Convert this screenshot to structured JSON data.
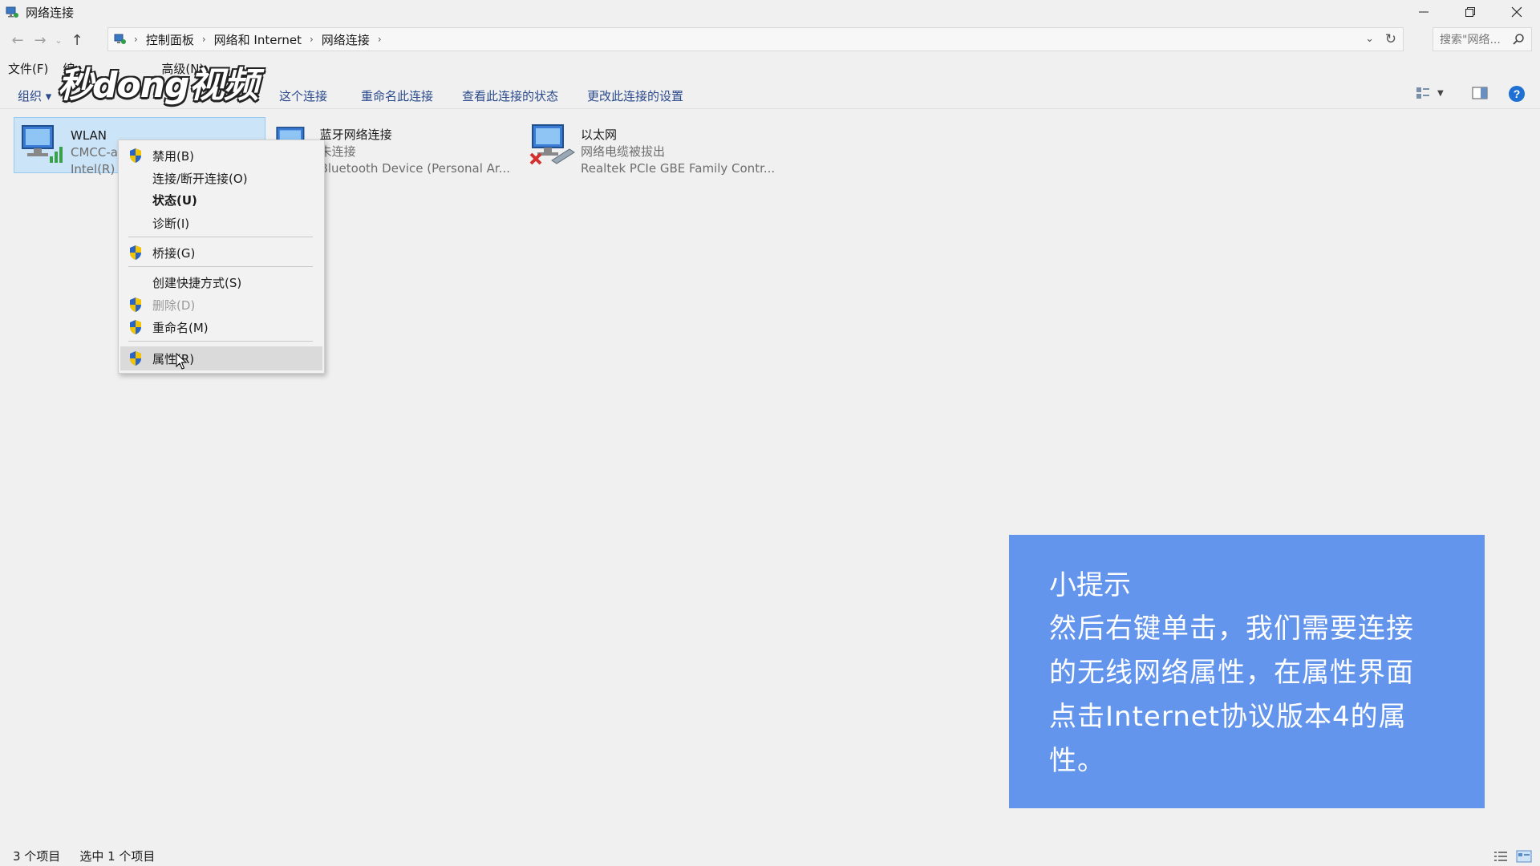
{
  "window": {
    "title": "网络连接",
    "controls": [
      "minimize",
      "restore",
      "close"
    ]
  },
  "address": {
    "crumbs": [
      "控制面板",
      "网络和 Internet",
      "网络连接"
    ],
    "search_placeholder": "搜索\"网络..."
  },
  "menubar": {
    "items": [
      "文件(F)",
      "编",
      "高级(N)"
    ]
  },
  "commandbar": {
    "organize": "组织 ▾",
    "items": [
      "这个连接",
      "重命名此连接",
      "查看此连接的状态",
      "更改此连接的设置"
    ]
  },
  "connections": [
    {
      "name": "WLAN",
      "line1": "CMCC-a",
      "line2": "Intel(R)",
      "icon": "wifi-network-icon"
    },
    {
      "name": "蓝牙网络连接",
      "line1": "未连接",
      "line2": "Bluetooth Device (Personal Ar...",
      "icon": "bluetooth-network-icon"
    },
    {
      "name": "以太网",
      "line1": "网络电缆被拔出",
      "line2": "Realtek PCIe GBE Family Contr...",
      "icon": "ethernet-network-icon"
    }
  ],
  "context_menu": {
    "items": [
      {
        "label": "禁用(B)",
        "shield": true
      },
      {
        "label": "连接/断开连接(O)",
        "shield": false
      },
      {
        "label": "状态(U)",
        "shield": false,
        "bold": true
      },
      {
        "label": "诊断(I)",
        "shield": false
      },
      {
        "label": "桥接(G)",
        "shield": true
      },
      {
        "label": "创建快捷方式(S)",
        "shield": false
      },
      {
        "label": "删除(D)",
        "shield": true,
        "disabled": true
      },
      {
        "label": "重命名(M)",
        "shield": true
      },
      {
        "label": "属性(R)",
        "shield": true,
        "highlighted": true
      }
    ]
  },
  "statusbar": {
    "count": "3 个项目",
    "selected": "选中 1 个项目"
  },
  "tip": {
    "title": "小提示",
    "lines": [
      "然后右键单击，我们需要连接",
      "的无线网络属性，在属性界面",
      "点击Internet协议版本4的属",
      "性。"
    ]
  },
  "watermark": {
    "text": "秒dong视频"
  },
  "colors": {
    "tip_background": "#6495ed",
    "selection": "#cce4f7",
    "link": "#2b4a8c"
  }
}
